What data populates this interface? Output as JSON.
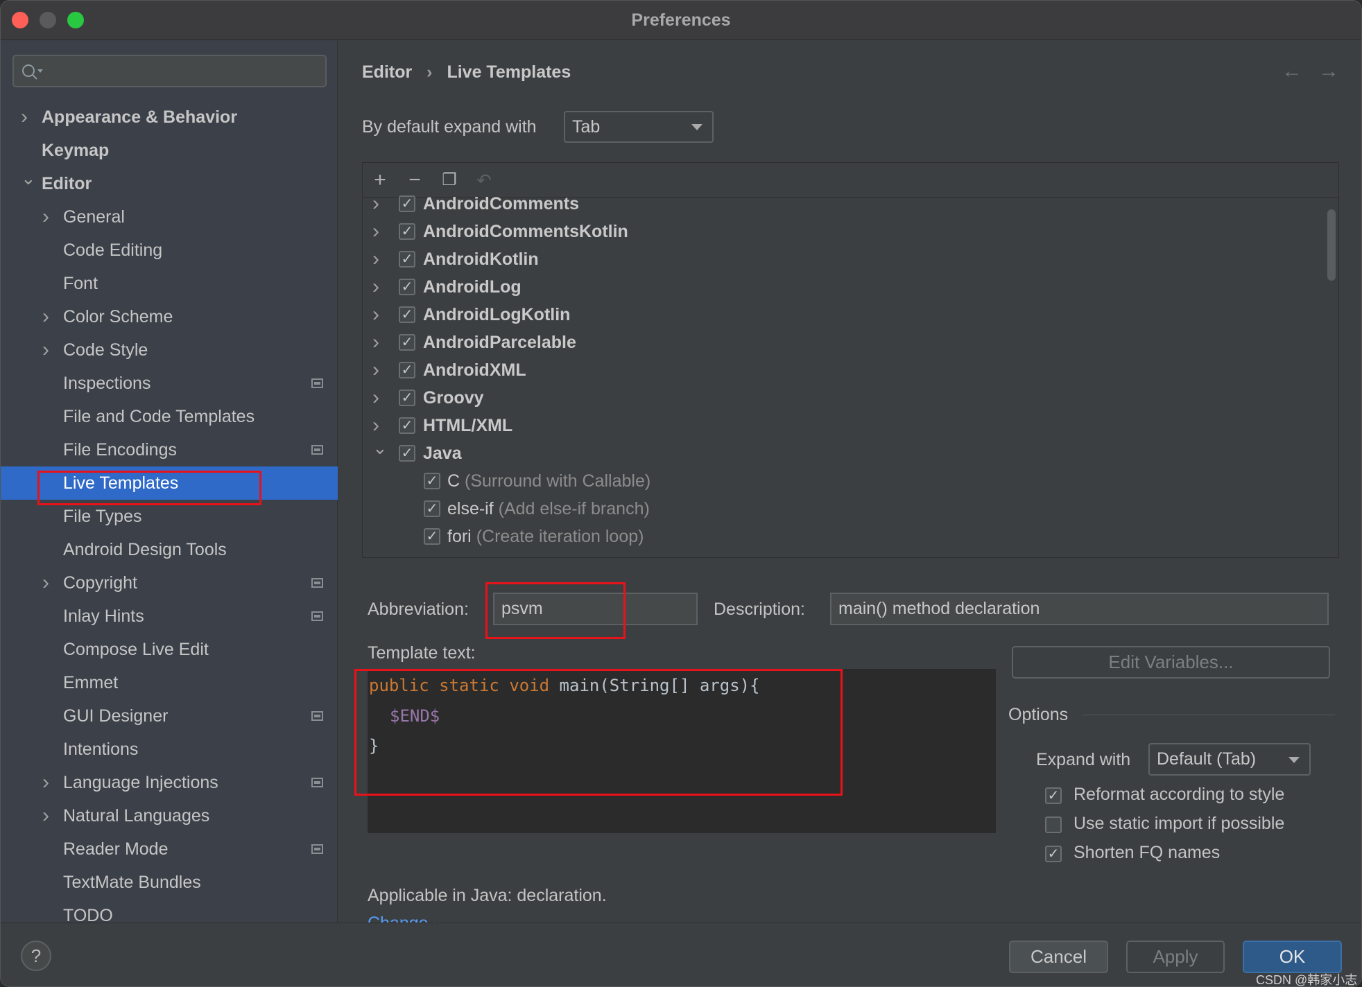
{
  "window": {
    "title": "Preferences"
  },
  "sidebar": {
    "search_placeholder": "",
    "items": [
      {
        "label": "Appearance & Behavior",
        "level": 0,
        "chevron": "right",
        "bold": true
      },
      {
        "label": "Keymap",
        "level": 0,
        "chevron": "none",
        "bold": true
      },
      {
        "label": "Editor",
        "level": 0,
        "chevron": "down",
        "bold": true
      },
      {
        "label": "General",
        "level": 1,
        "chevron": "right"
      },
      {
        "label": "Code Editing",
        "level": 1,
        "chevron": "none"
      },
      {
        "label": "Font",
        "level": 1,
        "chevron": "none"
      },
      {
        "label": "Color Scheme",
        "level": 1,
        "chevron": "right"
      },
      {
        "label": "Code Style",
        "level": 1,
        "chevron": "right"
      },
      {
        "label": "Inspections",
        "level": 1,
        "chevron": "none",
        "badge": true
      },
      {
        "label": "File and Code Templates",
        "level": 1,
        "chevron": "none"
      },
      {
        "label": "File Encodings",
        "level": 1,
        "chevron": "none",
        "badge": true
      },
      {
        "label": "Live Templates",
        "level": 1,
        "chevron": "none",
        "selected": true
      },
      {
        "label": "File Types",
        "level": 1,
        "chevron": "none"
      },
      {
        "label": "Android Design Tools",
        "level": 1,
        "chevron": "none"
      },
      {
        "label": "Copyright",
        "level": 1,
        "chevron": "right",
        "badge": true
      },
      {
        "label": "Inlay Hints",
        "level": 1,
        "chevron": "none",
        "badge": true
      },
      {
        "label": "Compose Live Edit",
        "level": 1,
        "chevron": "none"
      },
      {
        "label": "Emmet",
        "level": 1,
        "chevron": "none"
      },
      {
        "label": "GUI Designer",
        "level": 1,
        "chevron": "none",
        "badge": true
      },
      {
        "label": "Intentions",
        "level": 1,
        "chevron": "none"
      },
      {
        "label": "Language Injections",
        "level": 1,
        "chevron": "right",
        "badge": true
      },
      {
        "label": "Natural Languages",
        "level": 1,
        "chevron": "right"
      },
      {
        "label": "Reader Mode",
        "level": 1,
        "chevron": "none",
        "badge": true
      },
      {
        "label": "TextMate Bundles",
        "level": 1,
        "chevron": "none"
      },
      {
        "label": "TODO",
        "level": 1,
        "chevron": "none"
      }
    ]
  },
  "breadcrumb": {
    "parent": "Editor",
    "separator": "›",
    "current": "Live Templates"
  },
  "expand": {
    "label": "By default expand with",
    "value": "Tab"
  },
  "templates": {
    "groups": [
      {
        "name": "AndroidComments",
        "checked": true,
        "expanded": false
      },
      {
        "name": "AndroidCommentsKotlin",
        "checked": true,
        "expanded": false
      },
      {
        "name": "AndroidKotlin",
        "checked": true,
        "expanded": false
      },
      {
        "name": "AndroidLog",
        "checked": true,
        "expanded": false
      },
      {
        "name": "AndroidLogKotlin",
        "checked": true,
        "expanded": false
      },
      {
        "name": "AndroidParcelable",
        "checked": true,
        "expanded": false
      },
      {
        "name": "AndroidXML",
        "checked": true,
        "expanded": false
      },
      {
        "name": "Groovy",
        "checked": true,
        "expanded": false
      },
      {
        "name": "HTML/XML",
        "checked": true,
        "expanded": false
      },
      {
        "name": "Java",
        "checked": true,
        "expanded": true
      }
    ],
    "java_items": [
      {
        "abbr": "C",
        "desc": "(Surround with Callable)",
        "checked": true
      },
      {
        "abbr": "else-if",
        "desc": "(Add else-if branch)",
        "checked": true
      },
      {
        "abbr": "fori",
        "desc": "(Create iteration loop)",
        "checked": true
      }
    ]
  },
  "form": {
    "abbreviation_label": "Abbreviation:",
    "abbreviation": "psvm",
    "description_label": "Description:",
    "description": "main() method declaration",
    "template_text_label": "Template text:",
    "code": {
      "kw1": "public",
      "kw2": "static",
      "kw3": "void",
      "sig": " main(String[] args){",
      "var": "$END$",
      "close": "}"
    },
    "edit_variables": "Edit Variables...",
    "applicable": "Applicable in Java: declaration.",
    "change": "Change"
  },
  "options": {
    "title": "Options",
    "expand_label": "Expand with",
    "expand_value": "Default (Tab)",
    "checks": [
      {
        "label": "Reformat according to style",
        "checked": true
      },
      {
        "label": "Use static import if possible",
        "checked": false
      },
      {
        "label": "Shorten FQ names",
        "checked": true
      }
    ]
  },
  "footer": {
    "help": "?",
    "cancel": "Cancel",
    "apply": "Apply",
    "ok": "OK"
  },
  "watermark": "CSDN @韩家小志",
  "colors": {
    "accent": "#2f6ac8",
    "keyword": "#cc7832",
    "variable": "#9876aa",
    "link": "#589df6",
    "highlight_box": "#e8121a"
  }
}
